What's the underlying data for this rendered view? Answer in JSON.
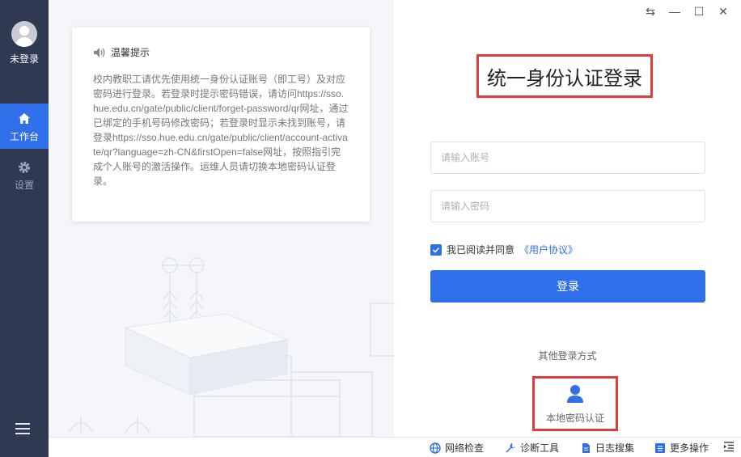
{
  "sidebar": {
    "user_label": "未登录",
    "items": [
      {
        "label": "工作台",
        "icon": "home-icon",
        "active": true
      },
      {
        "label": "设置",
        "icon": "gear-icon",
        "active": false
      }
    ],
    "menu_icon": "hamburger-menu-icon"
  },
  "tip": {
    "title": "温馨提示",
    "body": "校内教职工请优先使用统一身份认证账号（即工号）及对应密码进行登录。若登录时提示密码错误，请访问https://sso.hue.edu.cn/gate/public/client/forget-password/qr网址，通过已绑定的手机号码修改密码；若登录时显示未找到账号，请登录https://sso.hue.edu.cn/gate/public/client/account-activate/qr?language=zh-CN&firstOpen=false网址，按照指引完成个人账号的激活操作。运维人员请切换本地密码认证登录。"
  },
  "login": {
    "title": "统一身份认证登录",
    "account_placeholder": "请输入账号",
    "password_placeholder": "请输入密码",
    "agree_text": "我已阅读并同意",
    "agreement_link": "《用户协议》",
    "agree_checked": true,
    "submit_label": "登录",
    "other_methods_label": "其他登录方式",
    "local_auth_label": "本地密码认证"
  },
  "statusbar": {
    "network_check": "网络检查",
    "diagnostic_tools": "诊断工具",
    "log_collect": "日志搜集",
    "more_actions": "更多操作"
  },
  "colors": {
    "sidebar_bg": "#2f3a52",
    "accent": "#2f6fe9",
    "highlight_border": "#e23b3b"
  }
}
